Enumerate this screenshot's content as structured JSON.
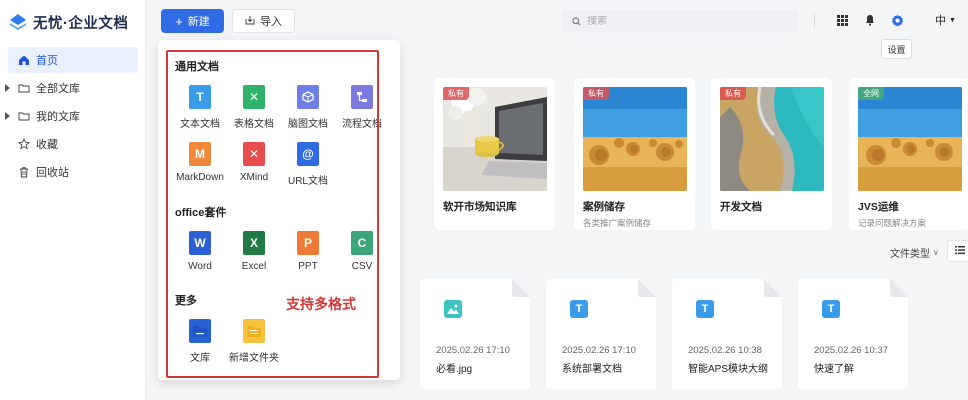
{
  "app": {
    "logo_text": "无忧·企业文档"
  },
  "sidebar": {
    "items": [
      {
        "label": "首页",
        "active": true
      },
      {
        "label": "全部文库",
        "expandable": true
      },
      {
        "label": "我的文库",
        "expandable": true
      },
      {
        "label": "收藏"
      },
      {
        "label": "回收站"
      }
    ]
  },
  "toolbar": {
    "new_label": "新建",
    "import_label": "导入",
    "search_placeholder": "搜索",
    "lang_label": "中",
    "settings_tooltip": "设置"
  },
  "dropdown": {
    "sections": [
      {
        "title": "通用文档",
        "items": [
          "文本文档",
          "表格文档",
          "脑图文档",
          "流程文档",
          "MarkDown",
          "XMind",
          "URL文档"
        ]
      },
      {
        "title": "office套件",
        "items": [
          "Word",
          "Excel",
          "PPT",
          "CSV"
        ]
      },
      {
        "title": "更多",
        "items": [
          "文库",
          "新增文件夹"
        ]
      }
    ],
    "annotation": "支持多格式"
  },
  "libraries": [
    {
      "tag": "私有",
      "title": "软开市场知识库",
      "subtitle": ""
    },
    {
      "tag": "私有",
      "title": "案例储存",
      "subtitle": "各类推广案例储存"
    },
    {
      "tag": "私有",
      "title": "开发文档",
      "subtitle": ""
    },
    {
      "tag": "全网",
      "title": "JVS运维",
      "subtitle": "记录问题解决方案"
    }
  ],
  "filter_label": "文件类型",
  "files": [
    {
      "date": "2025.02.26 17:10",
      "name": "必看.jpg",
      "type": "image"
    },
    {
      "date": "2025.02.26 17:10",
      "name": "系统部署文档",
      "type": "text"
    },
    {
      "date": "2025.02.26 10:38",
      "name": "智能APS模块大纲",
      "type": "text"
    },
    {
      "date": "2025.02.26 10:37",
      "name": "快速了解",
      "type": "text"
    }
  ],
  "colors": {
    "primary": "#2f6be5",
    "annotation": "#d23a3a"
  }
}
